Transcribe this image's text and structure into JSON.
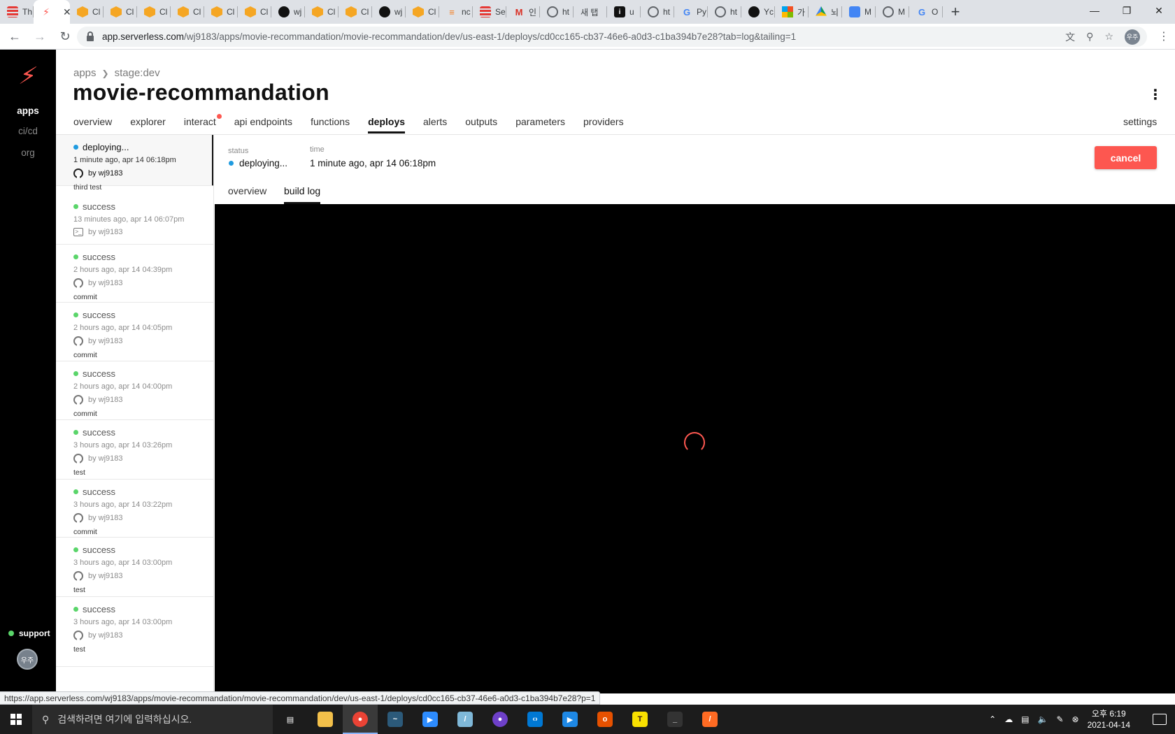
{
  "browser": {
    "tabs": [
      {
        "label": "Th",
        "icon": "list-icon"
      },
      {
        "label": "",
        "icon": "serverless-icon",
        "active": true
      },
      {
        "label": "Cl",
        "icon": "cube-icon"
      },
      {
        "label": "Cl",
        "icon": "cube-icon"
      },
      {
        "label": "Cl",
        "icon": "cube-icon"
      },
      {
        "label": "Cl",
        "icon": "cube-icon"
      },
      {
        "label": "Cl",
        "icon": "cube-icon"
      },
      {
        "label": "Cl",
        "icon": "cube-icon"
      },
      {
        "label": "wj",
        "icon": "github-icon"
      },
      {
        "label": "Cl",
        "icon": "cube-icon"
      },
      {
        "label": "Cl",
        "icon": "cube-icon"
      },
      {
        "label": "wj",
        "icon": "github-icon"
      },
      {
        "label": "Cl",
        "icon": "cube-icon"
      },
      {
        "label": "nc",
        "icon": "stackoverflow-icon"
      },
      {
        "label": "Se",
        "icon": "list-icon"
      },
      {
        "label": "인",
        "icon": "gmail-icon"
      },
      {
        "label": "ht",
        "icon": "globe-icon"
      },
      {
        "label": "새 탭",
        "icon": "none"
      },
      {
        "label": "u",
        "icon": "info-icon"
      },
      {
        "label": "ht",
        "icon": "globe-icon"
      },
      {
        "label": "Py",
        "icon": "google-icon"
      },
      {
        "label": "ht",
        "icon": "globe-icon"
      },
      {
        "label": "Yc",
        "icon": "github-icon"
      },
      {
        "label": "가",
        "icon": "microsoft-icon"
      },
      {
        "label": "뇌",
        "icon": "drive-icon"
      },
      {
        "label": "M",
        "icon": "docs-icon"
      },
      {
        "label": "M",
        "icon": "globe-icon"
      },
      {
        "label": "O",
        "icon": "google-icon"
      }
    ],
    "url_host": "app.serverless.com",
    "url_path": "/wj9183/apps/movie-recommandation/movie-recommandation/dev/us-east-1/deploys/cd0cc165-cb37-46e6-a0d3-c1ba394b7e28?tab=log&tailing=1",
    "profile": "우주",
    "status_url": "https://app.serverless.com/wj9183/apps/movie-recommandation/movie-recommandation/dev/us-east-1/deploys/cd0cc165-cb37-46e6-a0d3-c1ba394b7e28?p=1"
  },
  "rail": {
    "items": [
      "apps",
      "ci/cd",
      "org"
    ],
    "support": "support",
    "avatar": "우주"
  },
  "header": {
    "breadcrumb": [
      "apps",
      "stage:dev"
    ],
    "title": "movie-recommandation",
    "tabs": [
      "overview",
      "explorer",
      "interact",
      "api endpoints",
      "functions",
      "deploys",
      "alerts",
      "outputs",
      "parameters",
      "providers"
    ],
    "active_tab": "deploys",
    "settings": "settings"
  },
  "deploys": [
    {
      "status": "deploying...",
      "time": "1 minute ago, apr 14 06:18pm",
      "by": "by wj9183",
      "source": "github",
      "message": "third test",
      "active": true
    },
    {
      "status": "success",
      "time": "13 minutes ago, apr 14 06:07pm",
      "by": "by wj9183",
      "source": "terminal",
      "message": ""
    },
    {
      "status": "success",
      "time": "2 hours ago, apr 14 04:39pm",
      "by": "by wj9183",
      "source": "github",
      "message": "commit"
    },
    {
      "status": "success",
      "time": "2 hours ago, apr 14 04:05pm",
      "by": "by wj9183",
      "source": "github",
      "message": "commit"
    },
    {
      "status": "success",
      "time": "2 hours ago, apr 14 04:00pm",
      "by": "by wj9183",
      "source": "github",
      "message": "commit"
    },
    {
      "status": "success",
      "time": "3 hours ago, apr 14 03:26pm",
      "by": "by wj9183",
      "source": "github",
      "message": "test"
    },
    {
      "status": "success",
      "time": "3 hours ago, apr 14 03:22pm",
      "by": "by wj9183",
      "source": "github",
      "message": "commit"
    },
    {
      "status": "success",
      "time": "3 hours ago, apr 14 03:00pm",
      "by": "by wj9183",
      "source": "github",
      "message": "test"
    },
    {
      "status": "success",
      "time": "3 hours ago, apr 14 03:00pm",
      "by": "by wj9183",
      "source": "github",
      "message": "test"
    }
  ],
  "detail": {
    "status_label": "status",
    "status_value": "deploying...",
    "time_label": "time",
    "time_value": "1 minute ago, apr 14 06:18pm",
    "cancel": "cancel",
    "subtabs": [
      "overview",
      "build log"
    ],
    "active_subtab": "build log"
  },
  "taskbar": {
    "search_placeholder": "검색하려면 여기에 입력하십시오.",
    "apps": [
      "task-view",
      "file-explorer",
      "chrome",
      "mysql-workbench",
      "zoom",
      "notepad",
      "github-desktop",
      "vscode",
      "media-player",
      "office",
      "kakaotalk",
      "terminal",
      "sublime"
    ],
    "time": "오후 6:19",
    "date": "2021-04-14"
  },
  "colors": {
    "accent": "#fd5750",
    "deploying": "#1f9be0",
    "success": "#5ad56a",
    "log_bg": "#000000"
  }
}
